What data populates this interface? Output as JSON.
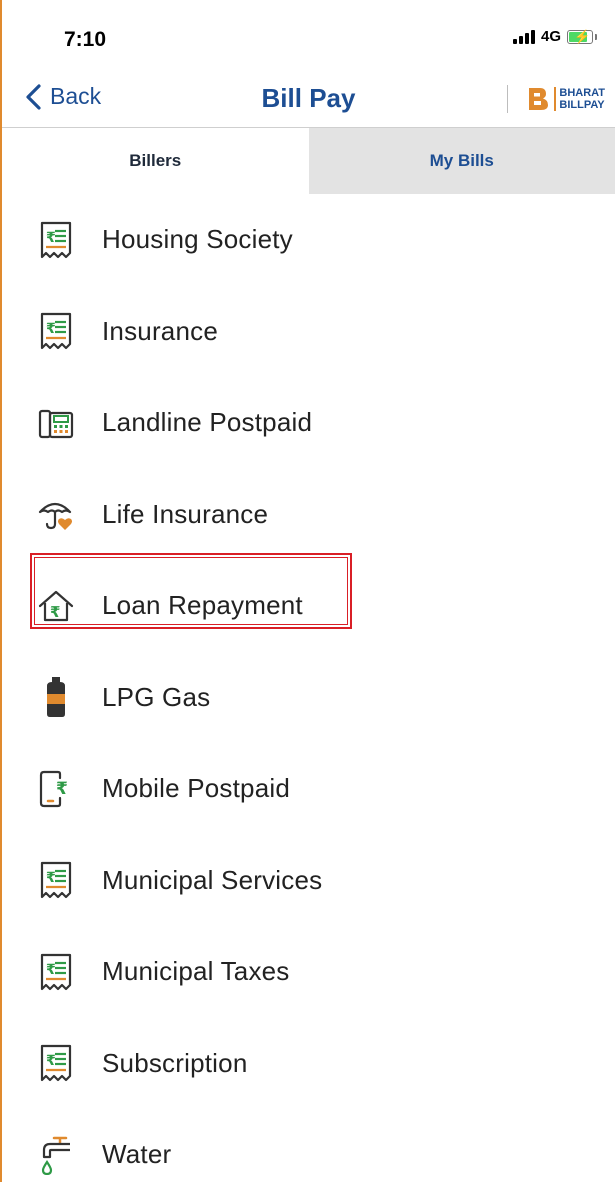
{
  "status_bar": {
    "time": "7:10",
    "network": "4G"
  },
  "nav": {
    "back_label": "Back",
    "title": "Bill Pay",
    "brand_line1": "BHARAT",
    "brand_line2": "BILLPAY"
  },
  "tabs": [
    {
      "label": "Billers",
      "active": true
    },
    {
      "label": "My Bills",
      "active": false
    }
  ],
  "billers": [
    {
      "label": "Housing Society",
      "icon": "bill-receipt-icon"
    },
    {
      "label": "Insurance",
      "icon": "bill-receipt-icon"
    },
    {
      "label": "Landline Postpaid",
      "icon": "landline-phone-icon"
    },
    {
      "label": "Life Insurance",
      "icon": "umbrella-heart-icon"
    },
    {
      "label": "Loan Repayment",
      "icon": "house-rupee-icon"
    },
    {
      "label": "LPG Gas",
      "icon": "gas-cylinder-icon"
    },
    {
      "label": "Mobile Postpaid",
      "icon": "mobile-rupee-icon"
    },
    {
      "label": "Municipal Services",
      "icon": "bill-receipt-icon"
    },
    {
      "label": "Municipal Taxes",
      "icon": "bill-receipt-icon"
    },
    {
      "label": "Subscription",
      "icon": "bill-receipt-icon"
    },
    {
      "label": "Water",
      "icon": "water-tap-icon"
    }
  ],
  "colors": {
    "brand_blue": "#1d4e93",
    "accent_orange": "#e08a2e",
    "icon_green": "#2e9a46",
    "highlight_red": "#d91f26"
  }
}
